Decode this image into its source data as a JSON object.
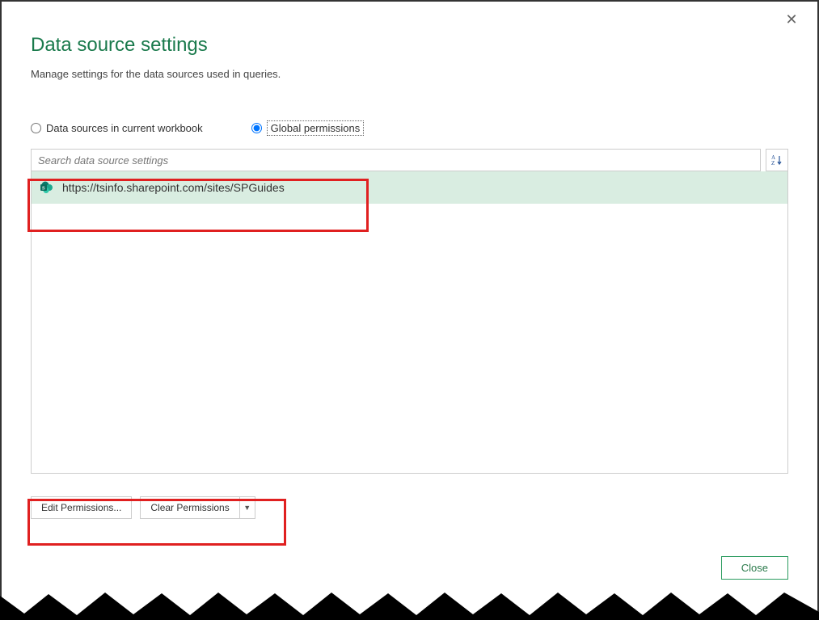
{
  "dialog": {
    "title": "Data source settings",
    "subtitle": "Manage settings for the data sources used in queries."
  },
  "scope": {
    "current_workbook_label": "Data sources in current workbook",
    "global_permissions_label": "Global permissions",
    "selected": "global"
  },
  "search": {
    "placeholder": "Search data source settings"
  },
  "data_sources": [
    {
      "url": "https://tsinfo.sharepoint.com/sites/SPGuides",
      "icon": "sharepoint-icon"
    }
  ],
  "buttons": {
    "edit_permissions": "Edit Permissions...",
    "clear_permissions": "Clear Permissions",
    "close": "Close"
  }
}
